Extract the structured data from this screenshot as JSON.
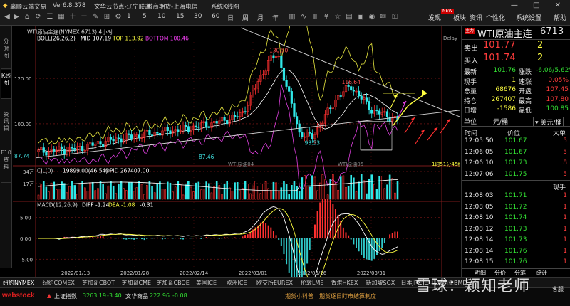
{
  "title_bar": {
    "app": "赢顺云端交易",
    "version": "Ver6.8.378",
    "cloud_node": "文华云节点-辽宁联通",
    "broker": "徽商期货-上海电信",
    "window_name": "系统K线图",
    "window_controls": "— □ ✕"
  },
  "toolbar": {
    "periods": [
      "1",
      "5",
      "10",
      "15",
      "30",
      "60",
      "日",
      "周",
      "月",
      "年"
    ],
    "right_menu": [
      "发现",
      "板块",
      "资讯",
      "个性化",
      "系统设置",
      "帮助"
    ],
    "new_badge": "NEW"
  },
  "left_tabs": [
    "分时图",
    "K线图",
    "资讯辑",
    "F10资料"
  ],
  "chart": {
    "header": "WTI原油主连(NYMEX 6713)  4小时",
    "boll_label": "BOLL(26,26,2)",
    "mid": "MID 107.19",
    "top": "TOP 113.92",
    "bottom": "BOTTOM 100.46",
    "delay": "Delay",
    "contract_marks": [
      "WTI原油04",
      "WTI原油05"
    ],
    "countdown": "1时51分45秒",
    "vol_label": "CJL(0)",
    "vol_value": "19899.00(46:54)",
    "opid": "OPID 267407.00",
    "macd_label": "MACD(12,26,9)",
    "diff": "DIFF -1.24",
    "dea": "DEA -1.08",
    "macd_val": "-0.31"
  },
  "chart_data": {
    "type": "candlestick",
    "price_axis_ticks": [
      120.0,
      100.0
    ],
    "price_annotations": [
      {
        "label": "130.50",
        "value": 130.5
      },
      {
        "label": "116.64",
        "value": 116.64
      },
      {
        "label": "93.53",
        "value": 93.53
      },
      {
        "label": "87.46",
        "value": 87.46
      },
      {
        "label": "87.74",
        "value": 87.74
      }
    ],
    "volume_axis_ticks": [
      "34万",
      "17万"
    ],
    "macd_axis_ticks": [
      5.0,
      0.0,
      -5.0
    ],
    "date_ticks": [
      "2022/01/13",
      "2022/01/28",
      "2022/02/14",
      "2022/03/01",
      "2022/03/16",
      "2022/03/31"
    ]
  },
  "quote": {
    "badge": "主力",
    "name": "WTI原油主连",
    "code": "6713",
    "sell_label": "卖出",
    "sell_price": "101.77",
    "sell_qty": "2",
    "buy_label": "买入",
    "buy_price": "101.74",
    "buy_qty": "2",
    "stats": [
      {
        "l1": "最新",
        "v1": "101.76",
        "c1": "green",
        "l2": "涨跌",
        "v2": "-6.06/5.62%",
        "c2": "green"
      },
      {
        "l1": "现手",
        "v1": "1",
        "c1": "yellow",
        "l2": "速涨",
        "v2": "0.05%",
        "c2": "red"
      },
      {
        "l1": "总量",
        "v1": "68676",
        "c1": "yellow",
        "l2": "开盘",
        "v2": "107.45",
        "c2": "red"
      },
      {
        "l1": "持仓",
        "v1": "267407",
        "c1": "yellow",
        "l2": "最高",
        "v2": "107.80",
        "c2": "red"
      },
      {
        "l1": "日增",
        "v1": "-1586",
        "c1": "yellow",
        "l2": "最低",
        "v2": "100.85",
        "c2": "green"
      }
    ],
    "unit_label": "单位",
    "unit_value": "元/桶",
    "unit_dropdown": "美元/桶",
    "tick_headers": [
      "时间",
      "价位",
      "大单"
    ],
    "ticks_top": [
      {
        "time": "12:05:50",
        "price": "101.67",
        "qty": "5"
      },
      {
        "time": "12:06:05",
        "price": "101.67",
        "qty": "5"
      },
      {
        "time": "12:06:10",
        "price": "101.73",
        "qty": "8"
      },
      {
        "time": "12:07:06",
        "price": "101.75",
        "qty": "5"
      }
    ],
    "tick_headers2": [
      "时间",
      "价位",
      "现手"
    ],
    "ticks_bottom": [
      {
        "time": "12:08:03",
        "price": "101.71",
        "qty": "1"
      },
      {
        "time": "12:08:05",
        "price": "101.72",
        "qty": "1"
      },
      {
        "time": "12:08:10",
        "price": "101.74",
        "qty": "1"
      },
      {
        "time": "12:08:12",
        "price": "101.73",
        "qty": "1"
      },
      {
        "time": "12:08:14",
        "price": "101.73",
        "qty": "1"
      },
      {
        "time": "12:08:14",
        "price": "101.76",
        "qty": "1"
      },
      {
        "time": "12:08:15",
        "price": "101.76",
        "qty": "1"
      }
    ],
    "footer_tabs": [
      "明细",
      "分价",
      "分笔",
      "统计"
    ]
  },
  "bottom_tabs": [
    "纽约NYMEX",
    "纽约COMEX",
    "芝加哥CBOT",
    "芝加哥CME",
    "芝加哥CBOE",
    "美国ICE",
    "欧洲ICE",
    "欧交所EUREX",
    "伦敦LME",
    "香港HKEX",
    "新加坡SGX",
    "日本JPX",
    "马来西亚BMD"
  ],
  "status": {
    "logo": "webstock",
    "index_label": "上证指数",
    "index_value": "3263.19",
    "index_change": "-3.40",
    "goods_label": "文华商品",
    "goods_value": "222.96",
    "goods_change": "-0.08",
    "tip": "期货小科普",
    "tip_text": "期货逐日盯市结算制度",
    "client": "客服"
  },
  "watermark": "雪球：颖知老师"
}
